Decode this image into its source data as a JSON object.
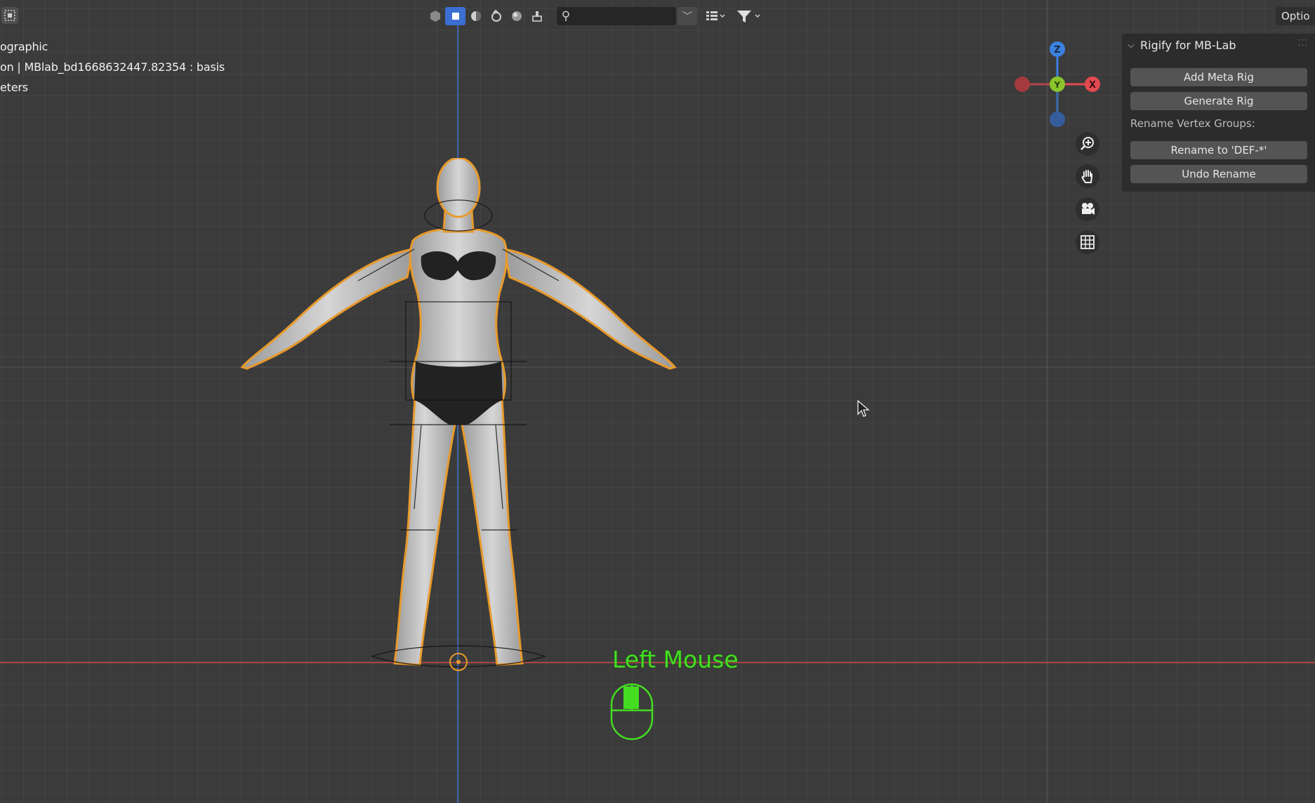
{
  "header": {
    "options_label": "Optio",
    "search_placeholder": "",
    "shading_modes": [
      "wireframe-icon",
      "solid-icon",
      "material-icon",
      "rendered-icon",
      "overlay-icon",
      "xray-icon"
    ]
  },
  "overlay": {
    "line1": "ographic",
    "line2": "on | MBlab_bd1668632447.82354 : basis",
    "line3": "eters"
  },
  "gizmo": {
    "z_label": "Z",
    "y_label": "Y",
    "x_label": "X",
    "colors": {
      "x": "#e24a50",
      "y": "#8ac52a",
      "z": "#3b82e0"
    }
  },
  "panel": {
    "title": "Rigify for MB-Lab",
    "add_meta_rig": "Add Meta Rig",
    "generate_rig": "Generate Rig",
    "rename_label": "Rename Vertex Groups:",
    "rename_to_def": "Rename to 'DEF-*'",
    "undo_rename": "Undo Rename"
  },
  "key_overlay": {
    "label": "Left Mouse",
    "color": "#44dd22"
  },
  "colors": {
    "accent": "#3b6fd1",
    "selection_outline": "#e89a2c"
  }
}
